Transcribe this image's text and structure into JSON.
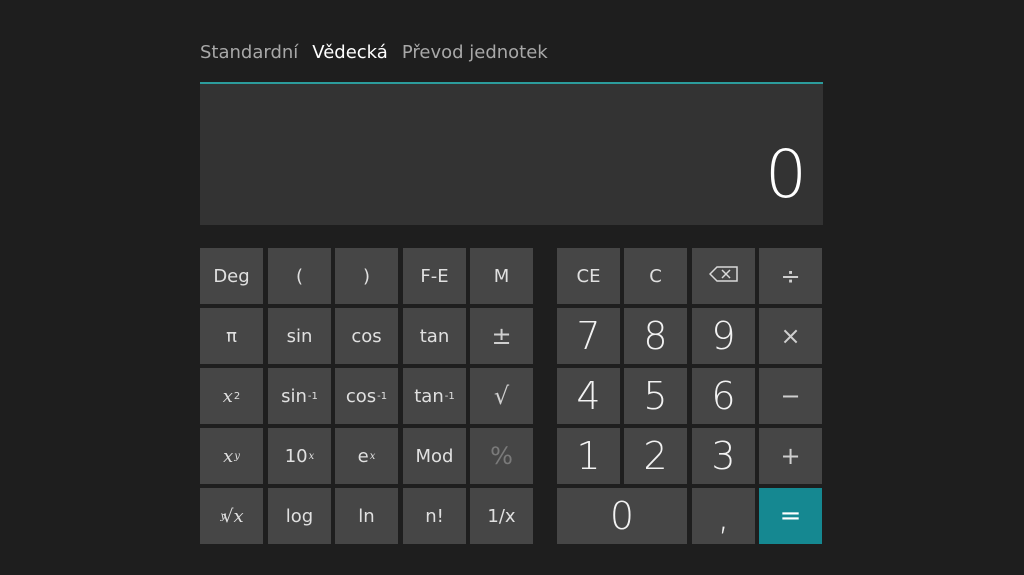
{
  "tabs": [
    {
      "label": "Standardní",
      "active": false
    },
    {
      "label": "Vědecká",
      "active": true
    },
    {
      "label": "Převod jednotek",
      "active": false
    }
  ],
  "display": {
    "value": "0"
  },
  "scientific_keys": {
    "deg": "Deg",
    "open_paren": "(",
    "close_paren": ")",
    "fe": "F-E",
    "m": "M",
    "pi": "π",
    "sin": "sin",
    "cos": "cos",
    "tan": "tan",
    "plusminus": "±",
    "x_squared_base": "x",
    "x_squared_exp": "2",
    "sin_inv_base": "sin",
    "sin_inv_exp": "-1",
    "cos_inv_base": "cos",
    "cos_inv_exp": "-1",
    "tan_inv_base": "tan",
    "tan_inv_exp": "-1",
    "sqrt": "√",
    "x_pow_y_base": "x",
    "x_pow_y_exp": "y",
    "ten_pow_x_base": "10",
    "ten_pow_x_exp": "x",
    "e_pow_x_base": "e",
    "e_pow_x_exp": "x",
    "mod": "Mod",
    "percent": "%",
    "yroot_exp": "y",
    "yroot_symbol": "√",
    "yroot_base": "x",
    "log": "log",
    "ln": "ln",
    "factorial": "n!",
    "reciprocal": "1/x"
  },
  "standard_keys": {
    "ce": "CE",
    "c": "C",
    "backspace": "⌫",
    "divide": "÷",
    "seven": "7",
    "eight": "8",
    "nine": "9",
    "multiply": "×",
    "four": "4",
    "five": "5",
    "six": "6",
    "minus": "−",
    "one": "1",
    "two": "2",
    "three": "3",
    "plus": "+",
    "zero": "0",
    "comma": ",",
    "equals": "="
  },
  "colors": {
    "accent": "#2c9c9c",
    "equals": "#158891"
  }
}
